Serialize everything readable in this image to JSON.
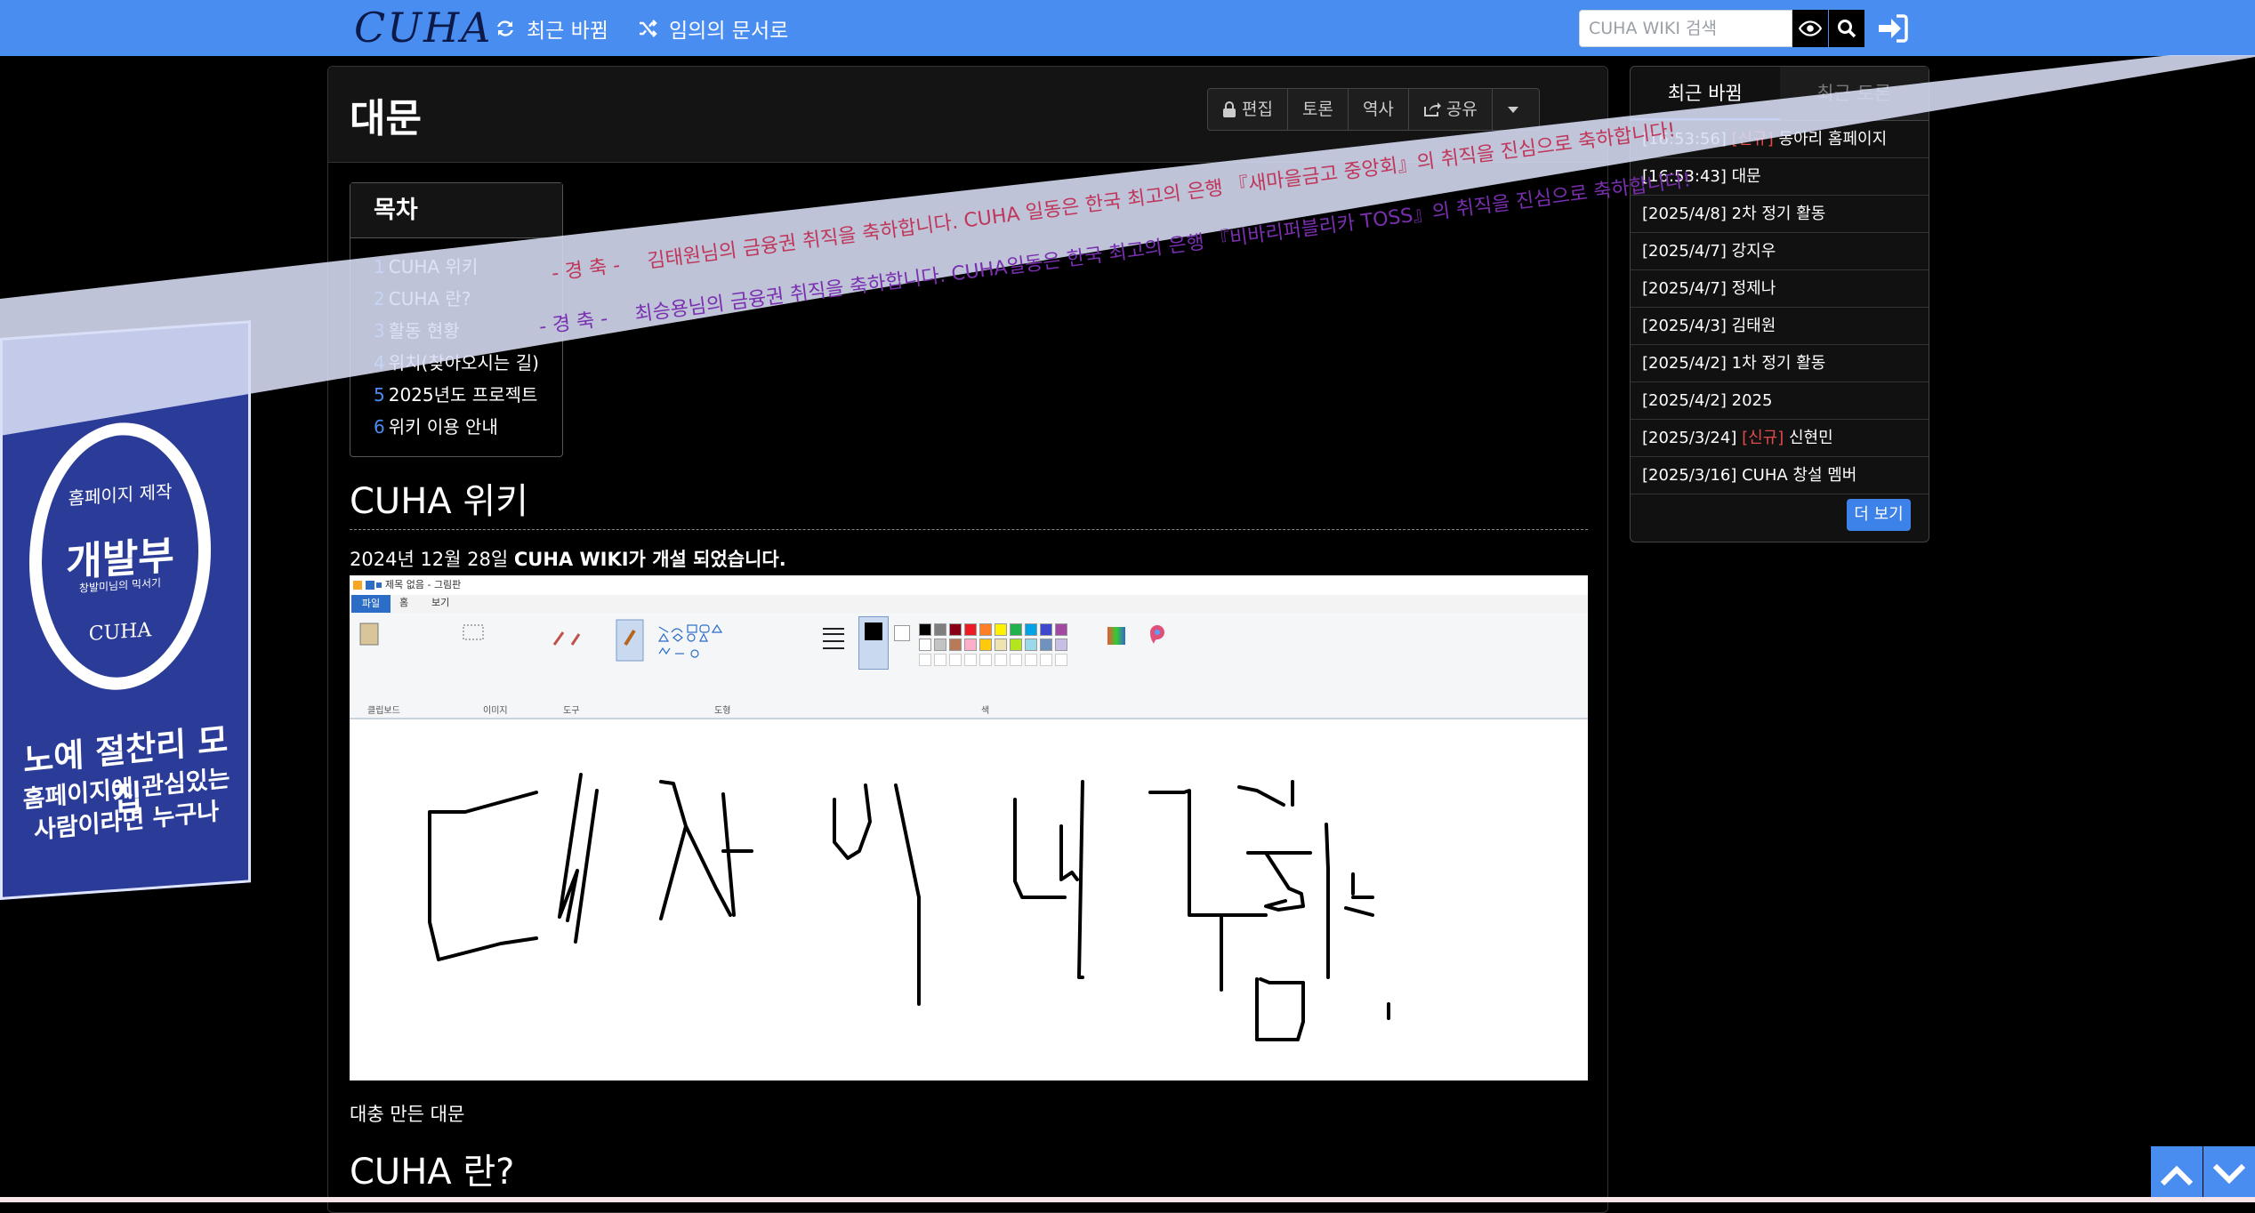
{
  "navbar": {
    "brand": "CUHA",
    "recent_changes": "최근 바뀜",
    "random_doc": "임의의 문서로",
    "search_placeholder": "CUHA WIKI 검색"
  },
  "article": {
    "title": "대문",
    "tools": {
      "edit": "편집",
      "discuss": "토론",
      "history": "역사",
      "share": "공유"
    },
    "toc": {
      "title": "목차",
      "items": [
        {
          "num": "1",
          "label": "CUHA 위키"
        },
        {
          "num": "2",
          "label": "CUHA 란?"
        },
        {
          "num": "3",
          "label": "활동 현황"
        },
        {
          "num": "4",
          "label": "위치(찾아오시는 길)"
        },
        {
          "num": "5",
          "label": "2025년도 프로젝트"
        },
        {
          "num": "6",
          "label": "위키 이용 안내"
        }
      ]
    },
    "section1_title": "CUHA 위키",
    "intro_date": "2024년 12월 28일",
    "intro_bold": "CUHA WIKI가 개설 되었습니다.",
    "image_caption": "대충 만든 대문",
    "section2_title": "CUHA 란?",
    "paint": {
      "window_title": "제목 없음 - 그림판",
      "tabs": [
        "파일",
        "홈",
        "보기"
      ],
      "groups": [
        "클립보드",
        "이미지",
        "도구",
        "도형",
        "색"
      ],
      "buttons": [
        "붙여넣기",
        "잘라내기",
        "복사",
        "선택",
        "자르기",
        "크기 조정",
        "회전",
        "브러시",
        "윤곽선",
        "채우기",
        "크기",
        "색 1",
        "색 2",
        "색 편집",
        "그림판 3D로 편집"
      ],
      "colors": [
        "#000000",
        "#7f7f7f",
        "#880015",
        "#ed1c24",
        "#ff7f27",
        "#fff200",
        "#22b14c",
        "#00a2e8",
        "#3f48cc",
        "#a349a4",
        "#ffffff",
        "#c3c3c3",
        "#b97a57",
        "#ffaec9",
        "#ffc90e",
        "#efe4b0",
        "#b5e61d",
        "#99d9ea",
        "#7092be",
        "#c8bfe7"
      ],
      "drawn_text": "디자이너 구함."
    }
  },
  "sidebar": {
    "tab_recent": "최근 바뀜",
    "tab_discussion": "최근 토론",
    "items": [
      {
        "time": "[16:53:56]",
        "tag": "[신규]",
        "title": "동아리 홈페이지"
      },
      {
        "time": "[16:53:43]",
        "tag": "",
        "title": "대문"
      },
      {
        "time": "[2025/4/8]",
        "tag": "",
        "title": "2차 정기 활동"
      },
      {
        "time": "[2025/4/7]",
        "tag": "",
        "title": "강지우"
      },
      {
        "time": "[2025/4/7]",
        "tag": "",
        "title": "정제나"
      },
      {
        "time": "[2025/4/3]",
        "tag": "",
        "title": "김태원"
      },
      {
        "time": "[2025/4/2]",
        "tag": "",
        "title": "1차 정기 활동"
      },
      {
        "time": "[2025/4/2]",
        "tag": "",
        "title": "2025"
      },
      {
        "time": "[2025/3/24]",
        "tag": "[신규]",
        "title": "신현민"
      },
      {
        "time": "[2025/3/16]",
        "tag": "",
        "title": "CUHA 창설 멤버"
      }
    ],
    "more": "더 보기"
  },
  "banner": {
    "seal_top": "홈페이지 제작",
    "seal_main": "개발부",
    "seal_sub": "창발미님의 믹서기",
    "seal_bottom": "CUHA",
    "line1": "노예 절찬리 모집",
    "line2": "홈페이지에 관심있는",
    "line3": "사람이라면 누구나"
  },
  "congrats": {
    "label": "- 경 축 -",
    "line1": "김태원님의 금융권 취직을 축하합니다. CUHA 일동은 한국 최고의 은행 『새마을금고 중앙회』의 취직을 진심으로 축하합니다!",
    "line2": "최승용님의 금융권 취직을 축하합니다. CUHA일동은 한국 최고의 은행 『비바리퍼블리카 TOSS』의 취직을 진심으로 축하합니다!"
  },
  "colors": {
    "accent": "#4a8df0",
    "new_tag": "#e04b4b",
    "banner_blue": "#2b3c98"
  }
}
